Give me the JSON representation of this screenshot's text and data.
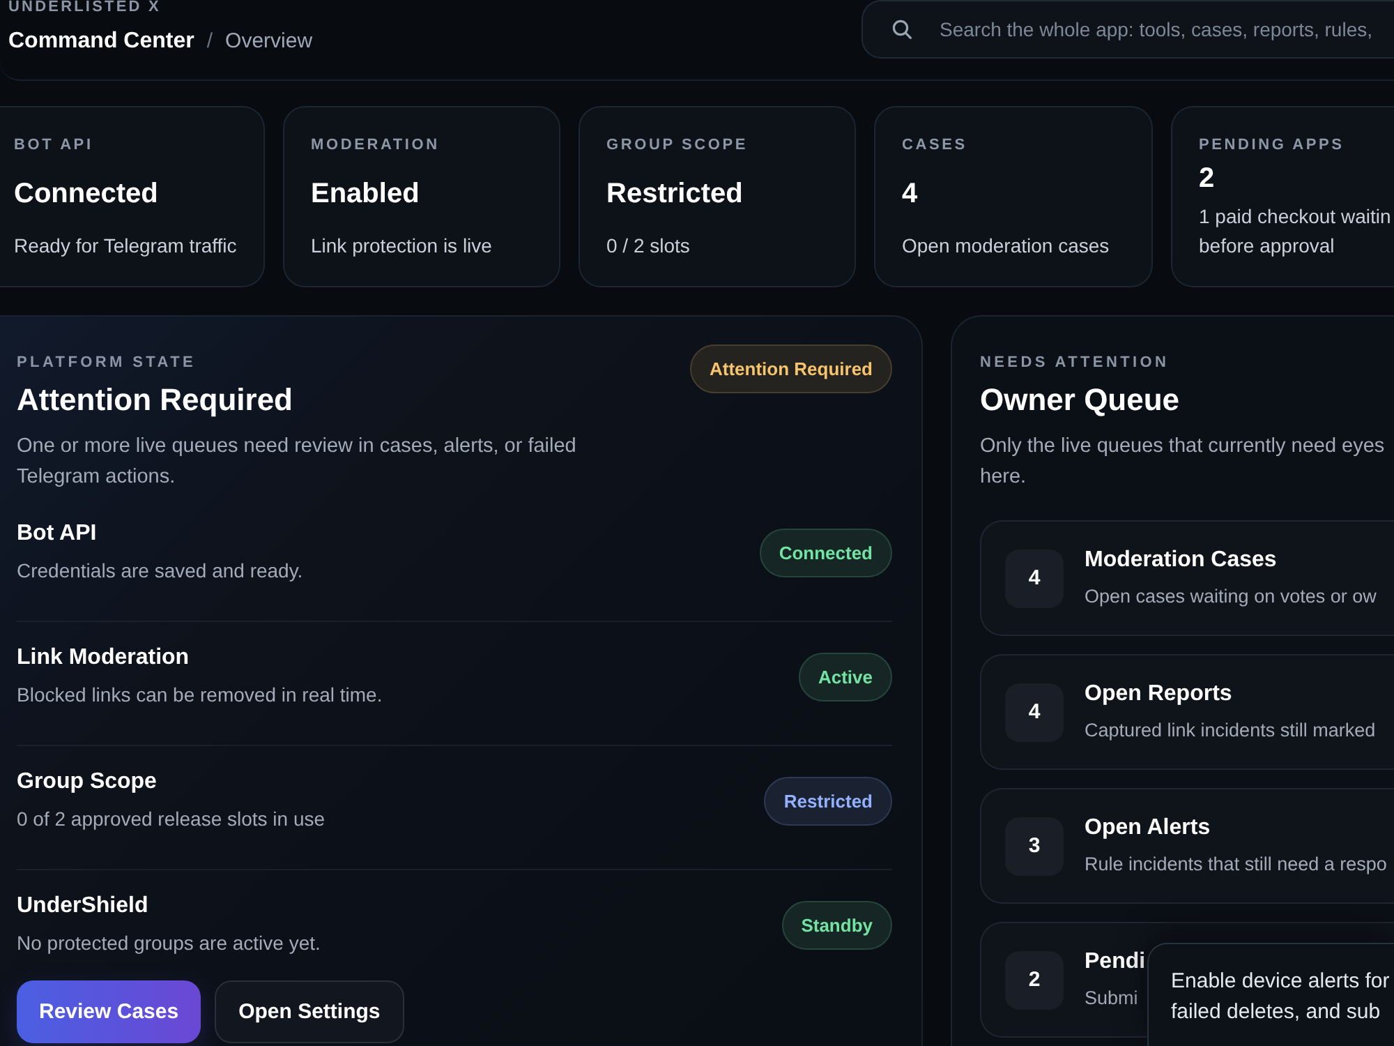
{
  "header": {
    "brand": "UNDERLISTED X",
    "title": "Command Center",
    "separator": "/",
    "breadcrumb": "Overview",
    "search": {
      "placeholder": "Search the whole app: tools, cases, reports, rules,"
    }
  },
  "stats": [
    {
      "label": "BOT API",
      "value": "Connected",
      "note": "Ready for Telegram traffic"
    },
    {
      "label": "MODERATION",
      "value": "Enabled",
      "note": "Link protection is live"
    },
    {
      "label": "GROUP SCOPE",
      "value": "Restricted",
      "note": "0 / 2 slots"
    },
    {
      "label": "CASES",
      "value": "4",
      "note": "Open moderation cases"
    },
    {
      "label": "PENDING APPS",
      "value": "2",
      "note": "1 paid checkout waitin before approval"
    }
  ],
  "platform_state": {
    "eyebrow": "PLATFORM STATE",
    "title": "Attention Required",
    "status": {
      "text": "Attention Required",
      "color": "#f5c46c"
    },
    "description": "One or more live queues need review in cases, alerts, or failed Telegram actions.",
    "items": [
      {
        "title": "Bot API",
        "note": "Credentials are saved and ready.",
        "status": {
          "text": "Connected",
          "color": "#72e3a2"
        }
      },
      {
        "title": "Link Moderation",
        "note": "Blocked links can be removed in real time.",
        "status": {
          "text": "Active",
          "color": "#72e3a2"
        }
      },
      {
        "title": "Group Scope",
        "note": "0 of 2 approved release slots in use",
        "status": {
          "text": "Restricted",
          "color": "#93b1ff"
        }
      },
      {
        "title": "UnderShield",
        "note": "No protected groups are active yet.",
        "status": {
          "text": "Standby",
          "color": "#72e3a2"
        }
      }
    ],
    "buttons": [
      {
        "label": "Review Cases",
        "kind": "primary"
      },
      {
        "label": "Open Settings",
        "kind": "secondary"
      }
    ]
  },
  "owner_queue": {
    "eyebrow": "NEEDS ATTENTION",
    "title": "Owner Queue",
    "description": "Only the live queues that currently need eyes here.",
    "items": [
      {
        "count": "4",
        "title": "Moderation Cases",
        "note": "Open cases waiting on votes or ow"
      },
      {
        "count": "4",
        "title": "Open Reports",
        "note": "Captured link incidents still marked"
      },
      {
        "count": "3",
        "title": "Open Alerts",
        "note": "Rule incidents that still need a respo"
      },
      {
        "count": "2",
        "title": "Pendi",
        "note": "Submi"
      }
    ]
  },
  "toast": {
    "text": "Enable device alerts for failed deletes, and sub"
  }
}
